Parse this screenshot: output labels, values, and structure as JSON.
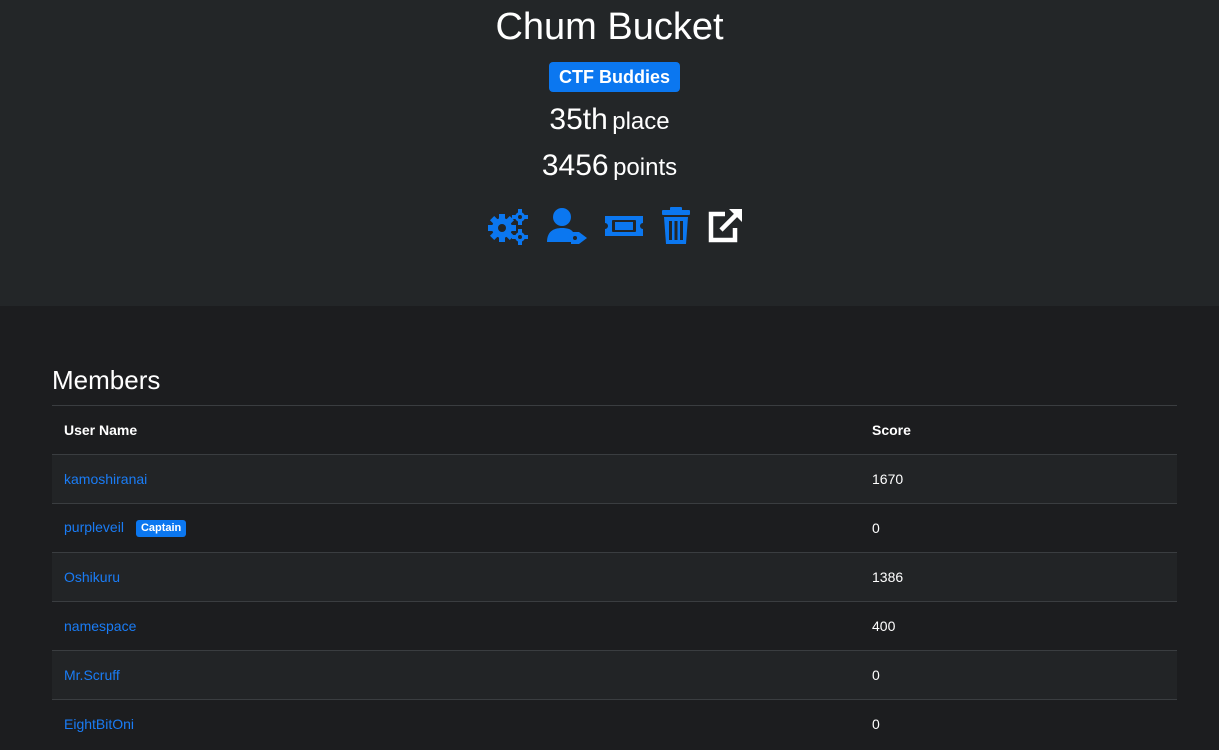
{
  "team": {
    "name": "Chum Bucket",
    "affiliation": "CTF Buddies",
    "place_value": "35th",
    "place_label": "place",
    "points_value": "3456",
    "points_label": "points"
  },
  "actions": [
    {
      "icon": "gears-icon",
      "color": "#0b77f0"
    },
    {
      "icon": "user-tag-icon",
      "color": "#0b77f0"
    },
    {
      "icon": "ticket-icon",
      "color": "#0b77f0"
    },
    {
      "icon": "trash-icon",
      "color": "#0b77f0"
    },
    {
      "icon": "external-link-icon",
      "color": "#ffffff"
    }
  ],
  "members": {
    "heading": "Members",
    "columns": {
      "user": "User Name",
      "score": "Score"
    },
    "captain_badge": "Captain",
    "rows": [
      {
        "name": "kamoshiranai",
        "score": "1670",
        "captain": false
      },
      {
        "name": "purpleveil",
        "score": "0",
        "captain": true
      },
      {
        "name": "Oshikuru",
        "score": "1386",
        "captain": false
      },
      {
        "name": "namespace",
        "score": "400",
        "captain": false
      },
      {
        "name": "Mr.Scruff",
        "score": "0",
        "captain": false
      },
      {
        "name": "EightBitOni",
        "score": "0",
        "captain": false
      }
    ]
  },
  "colors": {
    "accent": "#0b77f0",
    "link": "#1a7cf5",
    "header_bg": "#232628",
    "body_bg": "#1c1d1f"
  }
}
